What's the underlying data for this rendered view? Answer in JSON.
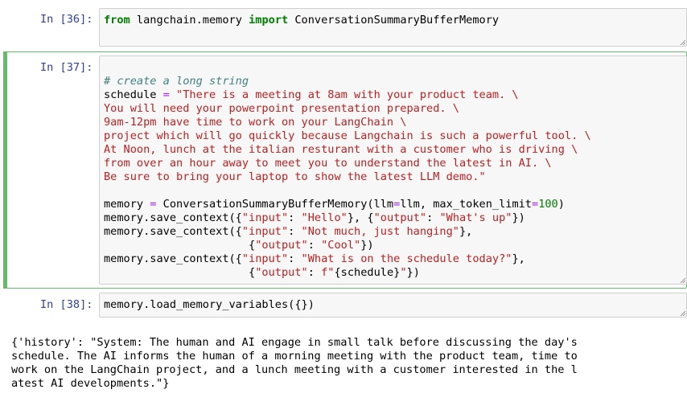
{
  "cells": [
    {
      "prompt": "In [36]:",
      "code": {
        "line1": {
          "kw_from": "from",
          "module": " langchain.memory ",
          "kw_import": "import",
          "name": " ConversationSummaryBufferMemory"
        }
      }
    },
    {
      "prompt": "In [37]:",
      "code": {
        "comment": "# create a long string",
        "sched_var": "schedule ",
        "sched_eq": "=",
        "sched_str_lines": [
          " \"There is a meeting at 8am with your product team. \\",
          "You will need your powerpoint presentation prepared. \\",
          "9am-12pm have time to work on your LangChain \\",
          "project which will go quickly because Langchain is such a powerful tool. \\",
          "At Noon, lunch at the italian resturant with a customer who is driving \\",
          "from over an hour away to meet you to understand the latest in AI. \\",
          "Be sure to bring your laptop to show the latest LLM demo.\""
        ],
        "mem_line": {
          "a": "memory ",
          "eq": "=",
          "b": " ConversationSummaryBufferMemory(llm",
          "eq2": "=",
          "c": "llm, max_token_limit",
          "eq3": "=",
          "num": "100",
          "d": ")"
        },
        "save1": {
          "a": "memory.save_context({",
          "s1": "\"input\"",
          "b": ": ",
          "s2": "\"Hello\"",
          "c": "}, {",
          "s3": "\"output\"",
          "d": ": ",
          "s4": "\"What's up\"",
          "e": "})"
        },
        "save2": {
          "a": "memory.save_context({",
          "s1": "\"input\"",
          "b": ": ",
          "s2": "\"Not much, just hanging\"",
          "c": "},"
        },
        "save2b": {
          "a": "                      {",
          "s1": "\"output\"",
          "b": ": ",
          "s2": "\"Cool\"",
          "c": "})"
        },
        "save3": {
          "a": "memory.save_context({",
          "s1": "\"input\"",
          "b": ": ",
          "s2": "\"What is on the schedule today?\"",
          "c": "},"
        },
        "save3b": {
          "a": "                      {",
          "s1": "\"output\"",
          "b": ": ",
          "s2": "f\"",
          "c": "{schedule}",
          "s3": "\"",
          "d": "})"
        }
      }
    },
    {
      "prompt": "In [38]:",
      "code": {
        "line1": "memory.load_memory_variables({})"
      },
      "output_lines": [
        "{'history': \"System: The human and AI engage in small talk before discussing the day's",
        "schedule. The AI informs the human of a morning meeting with the product team, time to",
        "work on the LangChain project, and a lunch meeting with a customer interested in the l",
        "atest AI developments.\"}"
      ]
    }
  ]
}
